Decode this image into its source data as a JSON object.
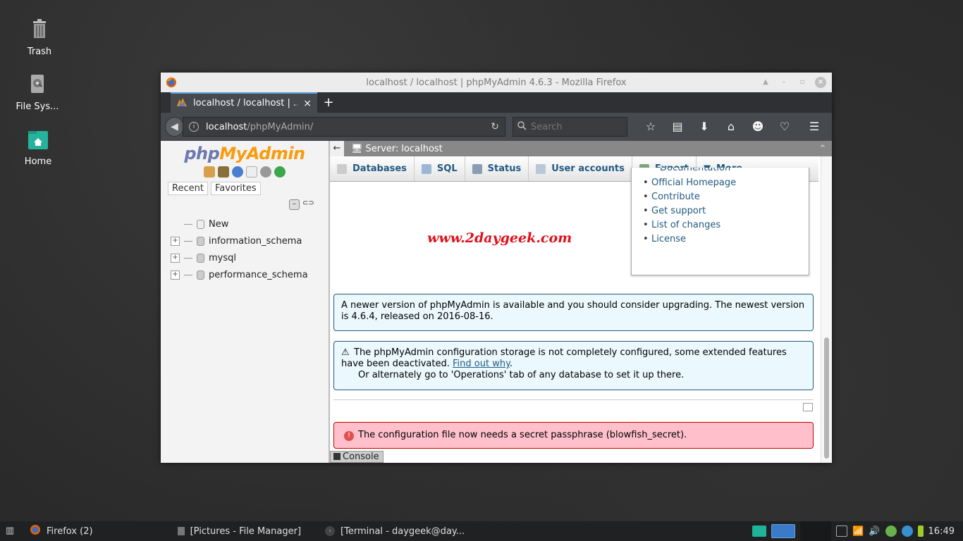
{
  "desktop": {
    "icons": [
      {
        "label": "Trash"
      },
      {
        "label": "File Sys..."
      },
      {
        "label": "Home"
      }
    ]
  },
  "window": {
    "title": "localhost / localhost | phpMyAdmin 4.6.3 - Mozilla Firefox"
  },
  "browser": {
    "tab_title": "localhost / localhost | ...",
    "new_tab": "+",
    "url_host": "localhost",
    "url_path": "/phpMyAdmin/",
    "search_placeholder": "Search"
  },
  "pma": {
    "logo_php": "php",
    "logo_myadmin": "MyAdmin",
    "nav_tabs": [
      "Recent",
      "Favorites"
    ],
    "db_tree": [
      {
        "name": "New"
      },
      {
        "name": "information_schema"
      },
      {
        "name": "mysql"
      },
      {
        "name": "performance_schema"
      }
    ],
    "server_label": "Server: localhost",
    "menu": [
      {
        "label": "Databases"
      },
      {
        "label": "SQL"
      },
      {
        "label": "Status"
      },
      {
        "label": "User accounts"
      },
      {
        "label": "Export"
      },
      {
        "label": "More"
      }
    ],
    "links_cut": "Documentation",
    "links": [
      "Official Homepage",
      "Contribute",
      "Get support",
      "List of changes",
      "License"
    ],
    "watermark": "www.2daygeek.com",
    "notice_upgrade": "A newer version of phpMyAdmin is available and you should consider upgrading. The newest version is 4.6.4, released on 2016-08-16.",
    "notice_config_1": "The phpMyAdmin configuration storage is not completely configured, some extended features have been deactivated.",
    "notice_config_link": "Find out why",
    "notice_config_2": "Or alternately go to 'Operations' tab of any database to set it up there.",
    "error_text": "The configuration file now needs a secret passphrase (blowfish_secret).",
    "console_label": "Console"
  },
  "taskbar": {
    "tasks": [
      {
        "label": "Firefox (2)"
      },
      {
        "label": "[Pictures - File Manager]"
      },
      {
        "label": "[Terminal - daygeek@day..."
      }
    ],
    "clock": "16:49"
  },
  "colors": {
    "pma_link": "#235a81",
    "error_bg": "#ffc0cb",
    "notice_bg": "#ebf8fd",
    "watermark": "#e0101a"
  }
}
